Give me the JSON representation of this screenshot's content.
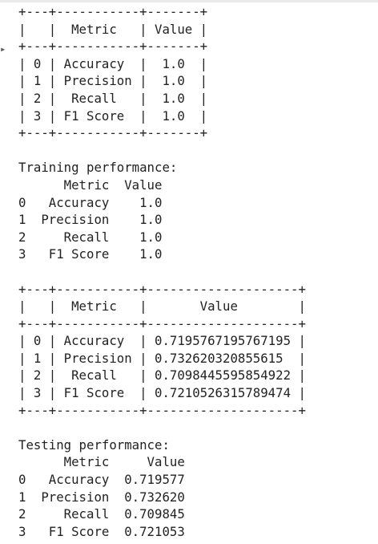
{
  "cell_output": {
    "lines": [
      "+---+-----------+-------+",
      "|   |  Metric   | Value |",
      "+---+-----------+-------+",
      "| 0 | Accuracy  |  1.0  |",
      "| 1 | Precision |  1.0  |",
      "| 2 |  Recall   |  1.0  |",
      "| 3 | F1 Score  |  1.0  |",
      "+---+-----------+-------+",
      "",
      "Training performance:",
      "      Metric  Value",
      "0   Accuracy    1.0",
      "1  Precision    1.0",
      "2     Recall    1.0",
      "3   F1 Score    1.0",
      "",
      "+---+-----------+--------------------+",
      "|   |  Metric   |       Value        |",
      "+---+-----------+--------------------+",
      "| 0 | Accuracy  | 0.7195767195767195 |",
      "| 1 | Precision | 0.732620320855615  |",
      "| 2 |  Recall   | 0.7098445595854922 |",
      "| 3 | F1 Score  | 0.7210526315789474 |",
      "+---+-----------+--------------------+",
      "",
      "Testing performance:",
      "      Metric     Value",
      "0   Accuracy  0.719577",
      "1  Precision  0.732620",
      "2     Recall  0.709845",
      "3   F1 Score  0.721053"
    ]
  }
}
